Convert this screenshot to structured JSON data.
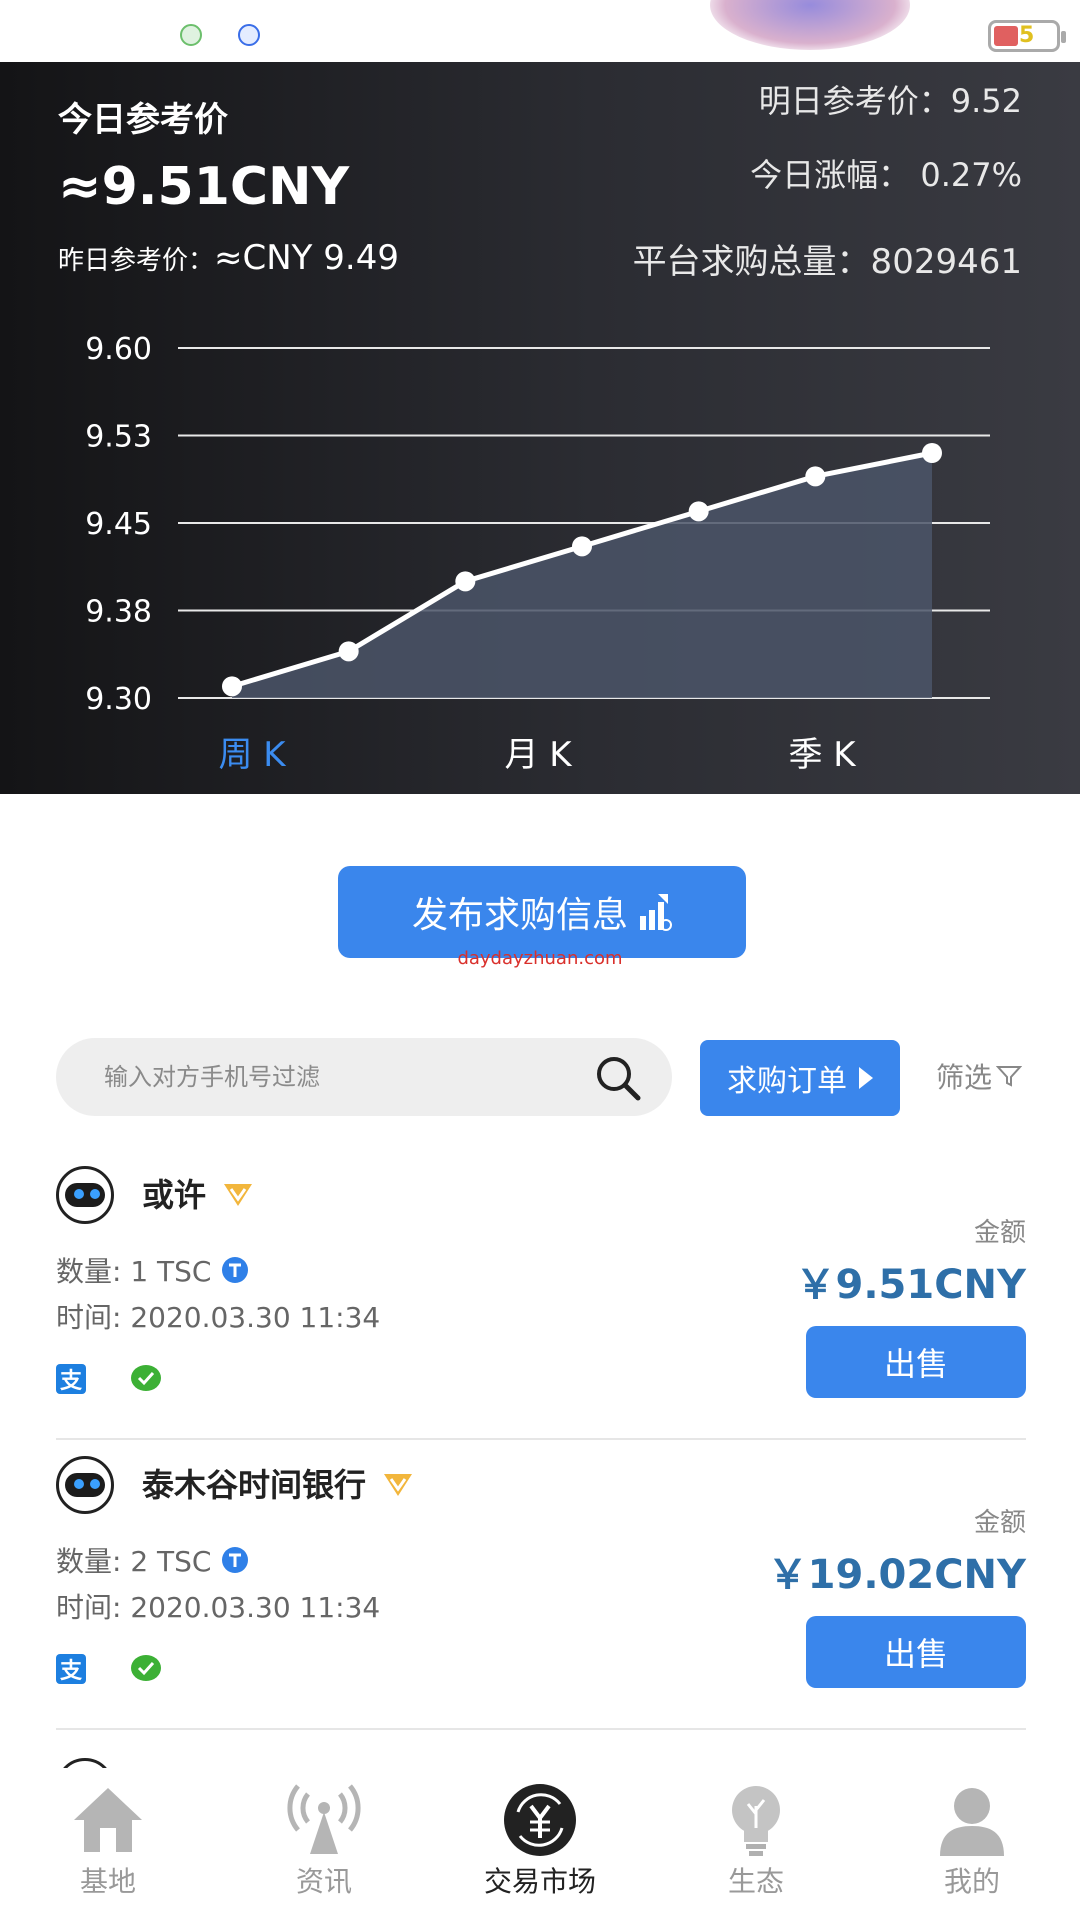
{
  "status_bar": {
    "battery_level": "5"
  },
  "market": {
    "today_label": "今日参考价",
    "today_price": "≈9.51CNY",
    "yesterday_label": "昨日参考价：",
    "yesterday_value": "≈CNY  9.49",
    "tomorrow": "明日参考价：9.52",
    "change": "今日涨幅：  0.27%",
    "total_demand": "平台求购总量：8029461",
    "accent_color": "#3b8cf0"
  },
  "chart_data": {
    "type": "area",
    "y_ticks": [
      "9.60",
      "9.53",
      "9.45",
      "9.38",
      "9.30"
    ],
    "ylim": [
      9.3,
      9.6
    ],
    "values": [
      9.31,
      9.34,
      9.4,
      9.43,
      9.46,
      9.49,
      9.51
    ],
    "grid": true,
    "line_color": "#ffffff",
    "fill_color": "#4b5568"
  },
  "k_tabs": [
    {
      "label": "周 K",
      "active": true
    },
    {
      "label": "月 K",
      "active": false
    },
    {
      "label": "季 K",
      "active": false
    }
  ],
  "publish_button": {
    "label": "发布求购信息",
    "icon": "chart-up-icon"
  },
  "watermark": "daydayzhuan.com",
  "search": {
    "placeholder": "输入对方手机号过滤",
    "icon": "search-icon"
  },
  "orders_button": {
    "label": "求购订单"
  },
  "filter": {
    "label": "筛选",
    "icon": "filter-icon"
  },
  "listings": [
    {
      "name": "或许",
      "quantity": "数量:  1  TSC",
      "time": "时间:  2020.03.30  11:34",
      "amount_label": "金额",
      "amount": "￥9.51CNY",
      "sell_label": "出售",
      "payments": [
        "alipay-icon",
        "wechat-pay-icon"
      ]
    },
    {
      "name": "泰木谷时间银行",
      "quantity": "数量:  2  TSC",
      "time": "时间:  2020.03.30  11:34",
      "amount_label": "金额",
      "amount": "￥19.02CNY",
      "sell_label": "出售",
      "payments": [
        "alipay-icon",
        "wechat-pay-icon"
      ]
    }
  ],
  "bottom_nav": [
    {
      "label": "基地",
      "icon": "house-icon",
      "active": false
    },
    {
      "label": "资讯",
      "icon": "antenna-icon",
      "active": false
    },
    {
      "label": "交易市场",
      "icon": "yuan-exchange-icon",
      "active": true
    },
    {
      "label": "生态",
      "icon": "lightbulb-icon",
      "active": false
    },
    {
      "label": "我的",
      "icon": "user-icon",
      "active": false
    }
  ]
}
